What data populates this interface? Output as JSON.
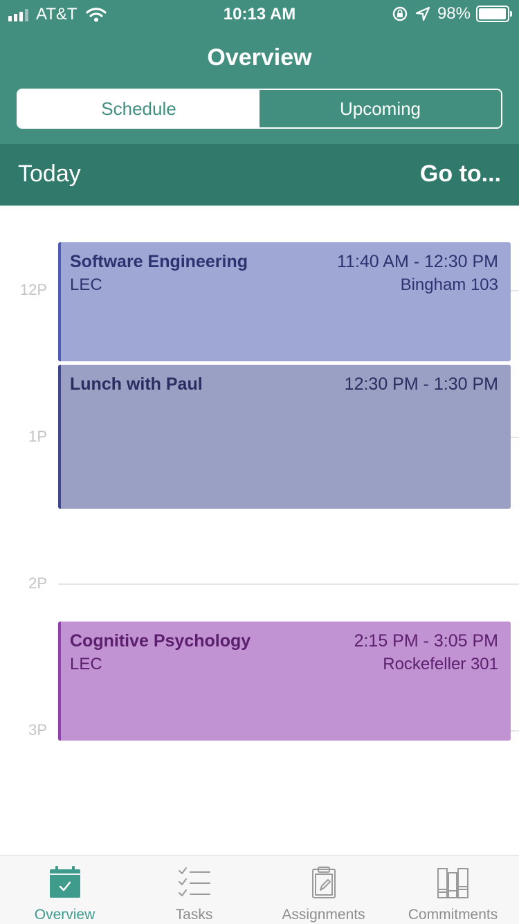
{
  "status": {
    "carrier": "AT&T",
    "time": "10:13 AM",
    "battery": "98%",
    "battery_level": 0.98
  },
  "header": {
    "title": "Overview",
    "tabs": [
      {
        "label": "Schedule",
        "active": true
      },
      {
        "label": "Upcoming",
        "active": false
      }
    ]
  },
  "subheader": {
    "today": "Today",
    "goto": "Go to..."
  },
  "timeline": {
    "hours": [
      "12P",
      "1P",
      "2P",
      "3P"
    ]
  },
  "events": [
    {
      "title": "Software Engineering",
      "time": "11:40 AM - 12:30 PM",
      "type": "LEC",
      "location": "Bingham 103",
      "color": "#9fa7d4"
    },
    {
      "title": "Lunch with Paul",
      "time": "12:30 PM - 1:30 PM",
      "type": "",
      "location": "",
      "color": "#9a9fc4"
    },
    {
      "title": "Cognitive Psychology",
      "time": "2:15 PM - 3:05 PM",
      "type": "LEC",
      "location": "Rockefeller 301",
      "color": "#c293d3"
    }
  ],
  "tabbar": {
    "items": [
      {
        "label": "Overview",
        "icon": "calendar-check-icon",
        "active": true
      },
      {
        "label": "Tasks",
        "icon": "checklist-icon",
        "active": false
      },
      {
        "label": "Assignments",
        "icon": "clipboard-icon",
        "active": false
      },
      {
        "label": "Commitments",
        "icon": "books-icon",
        "active": false
      }
    ]
  },
  "colors": {
    "header": "#428f80",
    "subheader": "#317a6b",
    "active_tab": "#3f9b8c"
  }
}
